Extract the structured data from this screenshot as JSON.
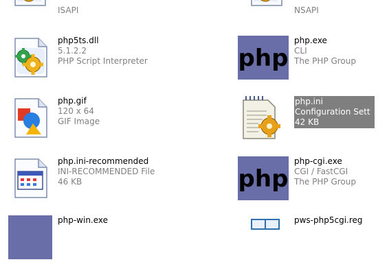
{
  "files": [
    {
      "name": "",
      "line2": "ISAPI",
      "line3": ""
    },
    {
      "name": "",
      "line2": "NSAPI",
      "line3": ""
    },
    {
      "name": "php5ts.dll",
      "line2": "5.1.2.2",
      "line3": "PHP Script Interpreter",
      "icon": "dll-gear-icon"
    },
    {
      "name": "php.exe",
      "line2": "CLI",
      "line3": "The PHP Group",
      "icon": "php-logo-icon"
    },
    {
      "name": "php.gif",
      "line2": "120 x 64",
      "line3": "GIF Image",
      "icon": "image-file-icon"
    },
    {
      "name": "php.ini",
      "line2": "Configuration Sett",
      "line3": "42 KB",
      "icon": "ini-config-icon",
      "selected": true
    },
    {
      "name": "php.ini-recommended",
      "line2": "INI-RECOMMENDED File",
      "line3": "46 KB",
      "icon": "generic-file-icon"
    },
    {
      "name": "php-cgi.exe",
      "line2": "CGI / FastCGI",
      "line3": "The PHP Group",
      "icon": "php-logo-icon"
    },
    {
      "name": "php-win.exe",
      "line2": "",
      "line3": "",
      "icon": "php-logo-icon"
    },
    {
      "name": "pws-php5cgi.reg",
      "line2": "",
      "line3": "",
      "icon": "registry-file-icon"
    }
  ],
  "colors": {
    "selection": "#7f7f7f",
    "php_purple": "#6a6ea8",
    "secondary_text": "#808080"
  }
}
